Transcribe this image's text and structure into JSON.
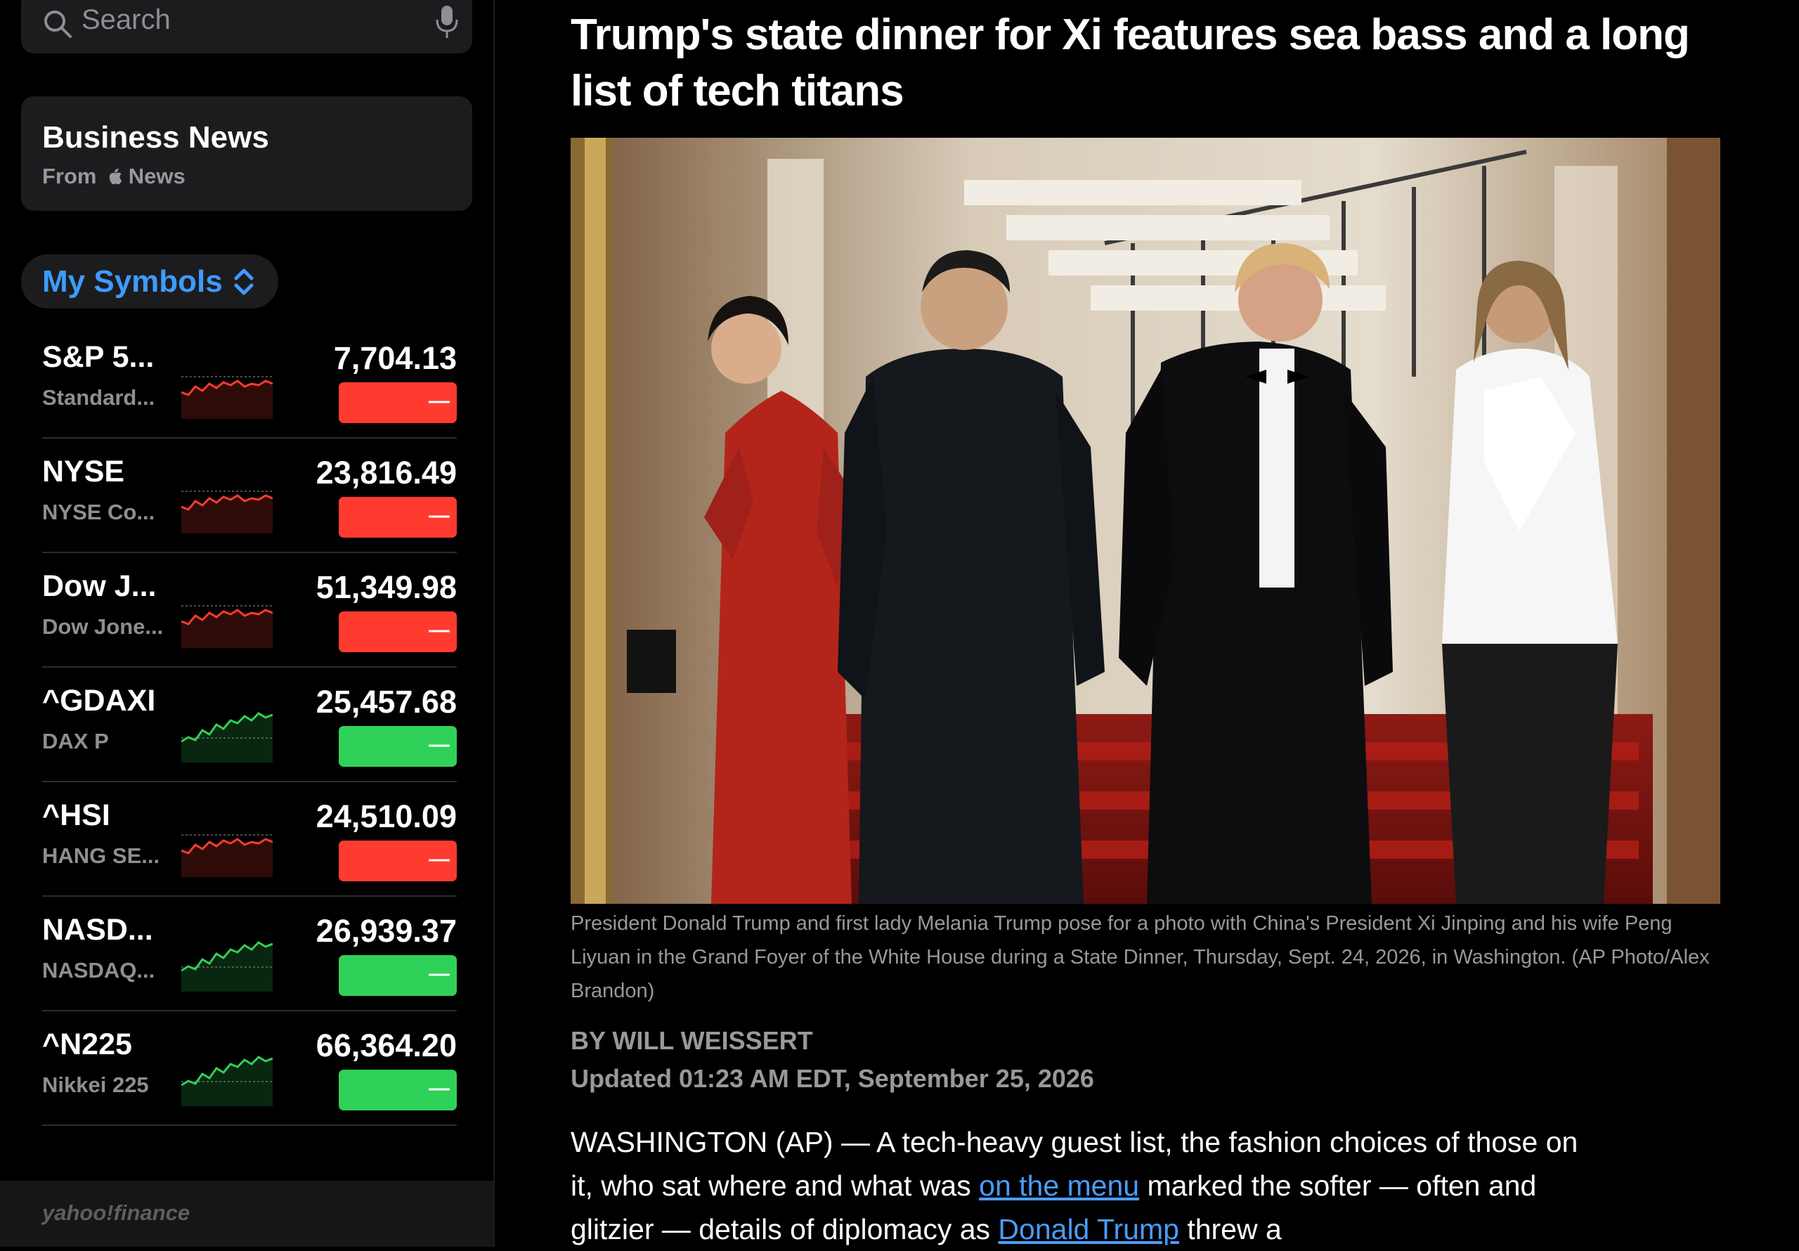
{
  "search": {
    "placeholder": "Search"
  },
  "business_card": {
    "title": "Business News",
    "from_prefix": "From",
    "from_brand": "News"
  },
  "symbols_selector": {
    "label": "My Symbols"
  },
  "stocks": [
    {
      "symbol": "S&P 5...",
      "name": "Standard...",
      "price": "7,704.13",
      "change": "—",
      "direction": "down"
    },
    {
      "symbol": "NYSE",
      "name": "NYSE Co...",
      "price": "23,816.49",
      "change": "—",
      "direction": "down"
    },
    {
      "symbol": "Dow J...",
      "name": "Dow Jone...",
      "price": "51,349.98",
      "change": "—",
      "direction": "down"
    },
    {
      "symbol": "^GDAXI",
      "name": "DAX P",
      "price": "25,457.68",
      "change": "—",
      "direction": "up"
    },
    {
      "symbol": "^HSI",
      "name": "HANG SE...",
      "price": "24,510.09",
      "change": "—",
      "direction": "down"
    },
    {
      "symbol": "NASD...",
      "name": "NASDAQ...",
      "price": "26,939.37",
      "change": "—",
      "direction": "up"
    },
    {
      "symbol": "^N225",
      "name": "Nikkei 225",
      "price": "66,364.20",
      "change": "—",
      "direction": "up"
    }
  ],
  "footer": {
    "logo": "yahoo!finance"
  },
  "article": {
    "headline": "Trump's state dinner for Xi features sea bass and a long list of tech titans",
    "caption": "President Donald Trump and first lady Melania Trump pose for a photo with China's President Xi Jinping and his wife Peng Liyuan in the Grand Foyer of the White House during a State Dinner, Thursday, Sept. 24, 2026, in Washington. (AP Photo/Alex Brandon)",
    "byline": "BY WILL WEISSERT",
    "updated": "Updated 01:23 AM EDT, September 25, 2026",
    "body_1": "WASHINGTON (AP) — A tech-heavy guest list, the fashion choices of those on it, who sat where and what was ",
    "link_1": "on the menu",
    "body_2": " marked the softer — often and glitzier — details of diplomacy as ",
    "link_2": "Donald Trump",
    "body_3": " threw a"
  },
  "colors": {
    "down": "#ff3b30",
    "up": "#30d158",
    "accent": "#3d9bff",
    "link": "#4a9cff"
  }
}
